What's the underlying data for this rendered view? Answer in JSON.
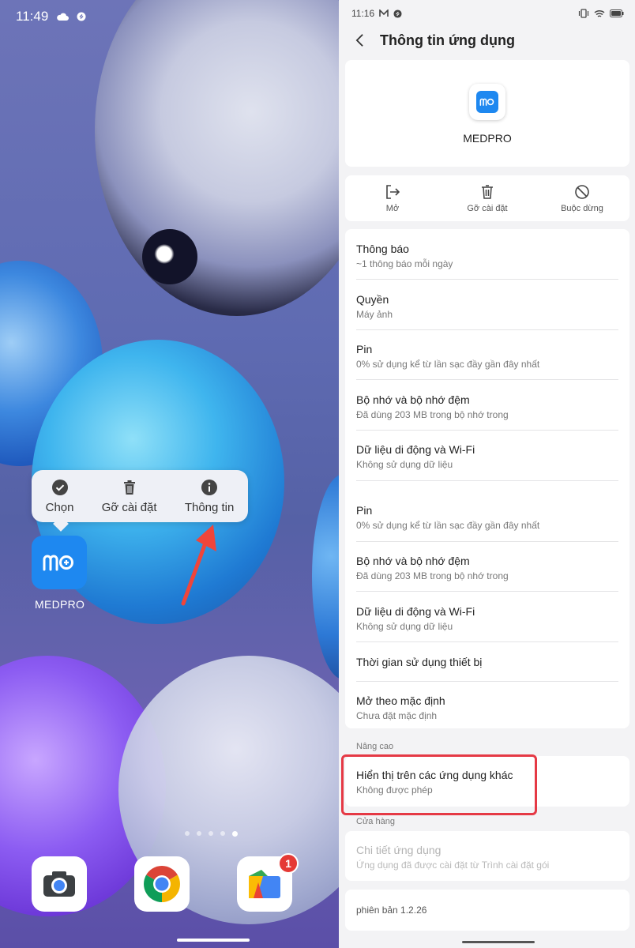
{
  "left_screen": {
    "status": {
      "time": "11:49",
      "icons": [
        "cloud-icon",
        "sync-icon"
      ]
    },
    "popup_menu": {
      "items": [
        {
          "label": "Chọn",
          "icon": "check-circle-icon"
        },
        {
          "label": "Gỡ cài đặt",
          "icon": "trash-icon"
        },
        {
          "label": "Thông tin",
          "icon": "info-icon"
        }
      ]
    },
    "app": {
      "label": "MEDPRO",
      "icon": "medpro-logo-icon"
    },
    "page_dots": {
      "count": 5,
      "active": 5
    },
    "dock": [
      {
        "icon": "camera-icon"
      },
      {
        "icon": "chrome-icon"
      },
      {
        "icon": "files-icon",
        "badge": "1"
      }
    ]
  },
  "right_screen": {
    "status": {
      "time": "11:16",
      "icons": [
        "mail-icon",
        "sync-icon",
        "vibrate-icon",
        "wifi-icon",
        "battery-icon"
      ]
    },
    "header": {
      "title": "Thông tin ứng dụng"
    },
    "app_card": {
      "name": "MEDPRO"
    },
    "actions": [
      {
        "label": "Mở",
        "icon": "open-icon"
      },
      {
        "label": "Gỡ cài đặt",
        "icon": "trash-icon"
      },
      {
        "label": "Buộc dừng",
        "icon": "block-icon"
      }
    ],
    "settings": [
      {
        "title": "Thông báo",
        "subtitle": "~1 thông báo mỗi ngày"
      },
      {
        "title": "Quyền",
        "subtitle": "Máy ảnh"
      },
      {
        "title": "Pin",
        "subtitle": "0% sử dụng kể từ lần sạc đầy gần đây nhất"
      },
      {
        "title": "Bộ nhớ và bộ nhớ đệm",
        "subtitle": "Đã dùng 203 MB trong bộ nhớ trong"
      },
      {
        "title": "Dữ liệu di động và Wi-Fi",
        "subtitle": "Không sử dụng dữ liệu"
      },
      {
        "title": "Pin",
        "subtitle": "0% sử dụng kể từ lần sạc đầy gần đây nhất"
      },
      {
        "title": "Bộ nhớ và bộ nhớ đệm",
        "subtitle": "Đã dùng 203 MB trong bộ nhớ trong"
      },
      {
        "title": "Dữ liệu di động và Wi-Fi",
        "subtitle": "Không sử dụng dữ liệu"
      },
      {
        "title": "Thời gian sử dụng thiết bị",
        "subtitle": ""
      },
      {
        "title": "Mở theo mặc định",
        "subtitle": "Chưa đặt mặc định"
      }
    ],
    "advanced": {
      "label": "Nâng cao",
      "item": {
        "title": "Hiển thị trên các ứng dụng khác",
        "subtitle": "Không được phép"
      }
    },
    "store": {
      "label": "Cửa hàng",
      "item": {
        "title": "Chi tiết ứng dụng",
        "subtitle": "Ứng dụng đã được cài đặt từ Trình cài đặt gói"
      }
    },
    "version": "phiên bản 1.2.26",
    "colors": {
      "highlight": "#e53945",
      "accent": "#1e88f0"
    }
  }
}
